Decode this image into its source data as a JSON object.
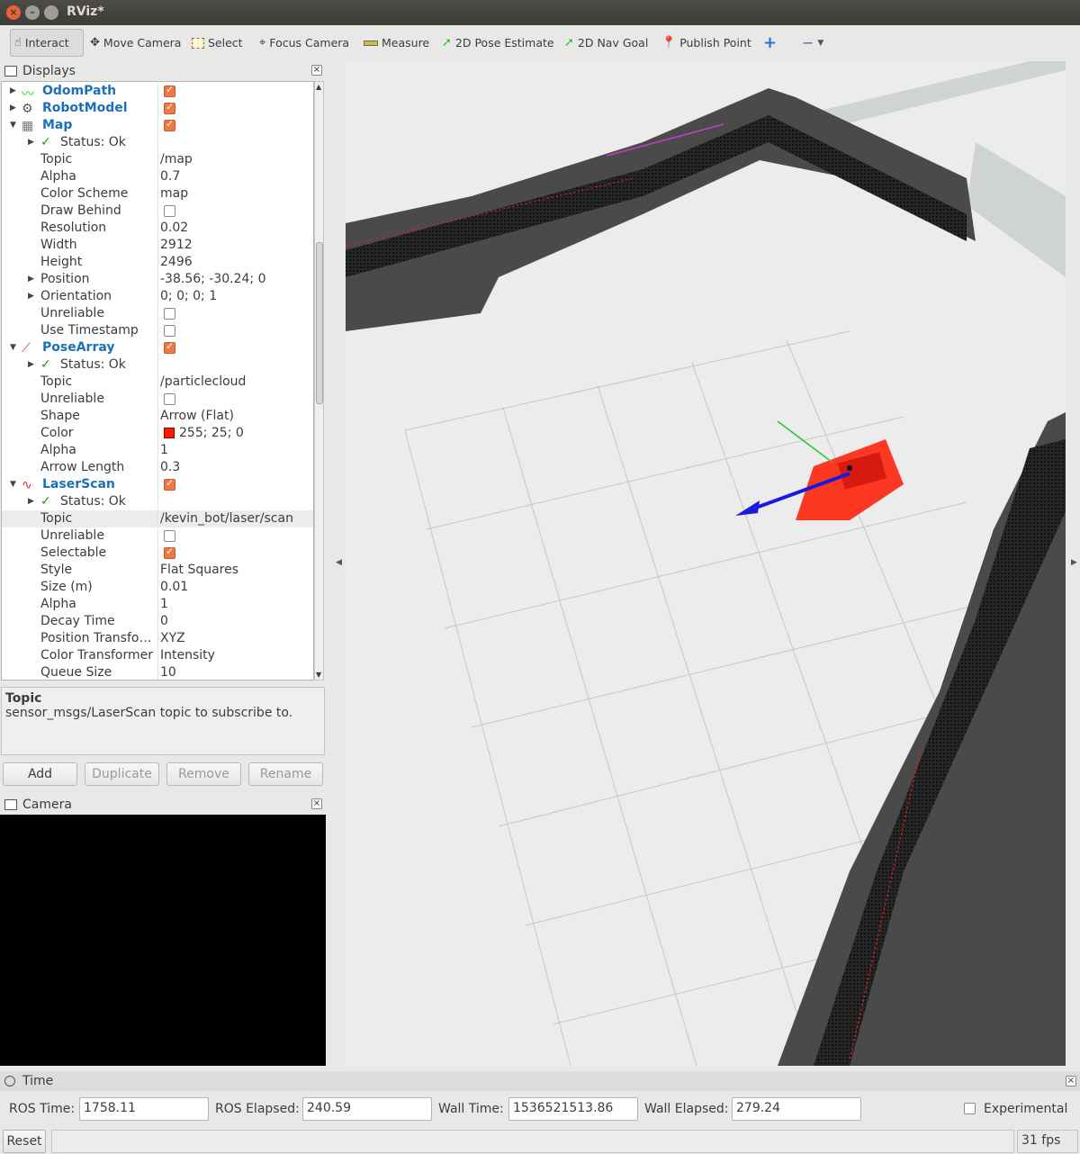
{
  "window": {
    "title": "RViz*"
  },
  "toolbar": {
    "tools": [
      {
        "label": "Interact",
        "icon": "hand-icon"
      },
      {
        "label": "Move Camera",
        "icon": "move-camera-icon"
      },
      {
        "label": "Select",
        "icon": "select-icon"
      },
      {
        "label": "Focus Camera",
        "icon": "focus-icon"
      },
      {
        "label": "Measure",
        "icon": "ruler-icon"
      },
      {
        "label": "2D Pose Estimate",
        "icon": "pose-arrow-icon"
      },
      {
        "label": "2D Nav Goal",
        "icon": "goal-arrow-icon"
      },
      {
        "label": "Publish Point",
        "icon": "pin-icon"
      }
    ]
  },
  "displays": {
    "title": "Displays",
    "rows": [
      {
        "kind": "display",
        "label": "OdomPath",
        "checked": true,
        "icon": "path-icon"
      },
      {
        "kind": "display",
        "label": "RobotModel",
        "checked": true,
        "icon": "robot-icon"
      },
      {
        "kind": "display",
        "label": "Map",
        "checked": true,
        "icon": "map-icon",
        "expanded": true
      },
      {
        "kind": "status",
        "label": "Status: Ok"
      },
      {
        "kind": "prop",
        "label": "Topic",
        "value": "/map"
      },
      {
        "kind": "prop",
        "label": "Alpha",
        "value": "0.7"
      },
      {
        "kind": "prop",
        "label": "Color Scheme",
        "value": "map"
      },
      {
        "kind": "propcb",
        "label": "Draw Behind",
        "checked": false
      },
      {
        "kind": "prop",
        "label": "Resolution",
        "value": "0.02"
      },
      {
        "kind": "prop",
        "label": "Width",
        "value": "2912"
      },
      {
        "kind": "prop",
        "label": "Height",
        "value": "2496"
      },
      {
        "kind": "propx",
        "label": "Position",
        "value": "-38.56; -30.24; 0"
      },
      {
        "kind": "propx",
        "label": "Orientation",
        "value": "0; 0; 0; 1"
      },
      {
        "kind": "propcb",
        "label": "Unreliable",
        "checked": false
      },
      {
        "kind": "propcb",
        "label": "Use Timestamp",
        "checked": false
      },
      {
        "kind": "display",
        "label": "PoseArray",
        "checked": true,
        "icon": "posearray-icon",
        "expanded": true
      },
      {
        "kind": "status",
        "label": "Status: Ok"
      },
      {
        "kind": "prop",
        "label": "Topic",
        "value": "/particlecloud"
      },
      {
        "kind": "propcb",
        "label": "Unreliable",
        "checked": false
      },
      {
        "kind": "prop",
        "label": "Shape",
        "value": "Arrow (Flat)"
      },
      {
        "kind": "propcolor",
        "label": "Color",
        "value": "255; 25; 0",
        "color": "#ff1900"
      },
      {
        "kind": "prop",
        "label": "Alpha",
        "value": "1"
      },
      {
        "kind": "prop",
        "label": "Arrow Length",
        "value": "0.3"
      },
      {
        "kind": "display",
        "label": "LaserScan",
        "checked": true,
        "icon": "laserscan-icon",
        "expanded": true
      },
      {
        "kind": "status",
        "label": "Status: Ok"
      },
      {
        "kind": "prop",
        "label": "Topic",
        "value": "/kevin_bot/laser/scan",
        "selected": true
      },
      {
        "kind": "propcb",
        "label": "Unreliable",
        "checked": false
      },
      {
        "kind": "propcb",
        "label": "Selectable",
        "checked": true
      },
      {
        "kind": "prop",
        "label": "Style",
        "value": "Flat Squares"
      },
      {
        "kind": "prop",
        "label": "Size (m)",
        "value": "0.01"
      },
      {
        "kind": "prop",
        "label": "Alpha",
        "value": "1"
      },
      {
        "kind": "prop",
        "label": "Decay Time",
        "value": "0"
      },
      {
        "kind": "prop",
        "label": "Position Transfo…",
        "value": "XYZ"
      },
      {
        "kind": "prop",
        "label": "Color Transformer",
        "value": "Intensity"
      },
      {
        "kind": "prop",
        "label": "Queue Size",
        "value": "10"
      }
    ]
  },
  "description": {
    "title": "Topic",
    "text": "sensor_msgs/LaserScan topic to subscribe to."
  },
  "buttons": {
    "add": "Add",
    "duplicate": "Duplicate",
    "remove": "Remove",
    "rename": "Rename"
  },
  "camera_panel": {
    "title": "Camera"
  },
  "time_panel": {
    "title": "Time",
    "ros_time_label": "ROS Time:",
    "ros_time": "1758.11",
    "ros_elapsed_label": "ROS Elapsed:",
    "ros_elapsed": "240.59",
    "wall_time_label": "Wall Time:",
    "wall_time": "1536521513.86",
    "wall_elapsed_label": "Wall Elapsed:",
    "wall_elapsed": "279.24",
    "experimental_label": "Experimental"
  },
  "statusbar": {
    "reset": "Reset",
    "fps": "31 fps"
  },
  "colors": {
    "accent": "#f07746",
    "particle": "#ff1900",
    "link": "#1d6fb8"
  }
}
